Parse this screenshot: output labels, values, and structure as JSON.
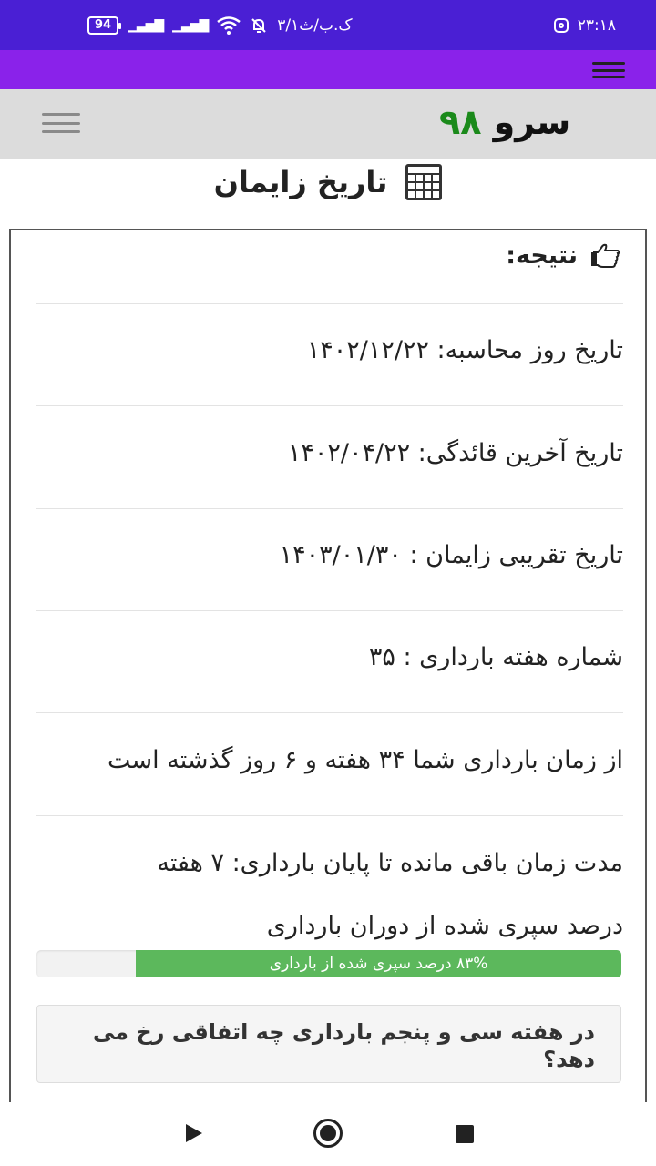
{
  "status_bar": {
    "time": "۲۳:۱۸",
    "speed": "۳/۱ک.ب/ث",
    "battery": "94"
  },
  "app": {
    "logo_word": "سرو",
    "logo_number": "۹۸"
  },
  "page": {
    "title": "تاریخ زایمان"
  },
  "result": {
    "heading": "نتیجه:",
    "calc_date": "تاریخ روز محاسبه: ۱۴۰۲/۱۲/۲۲",
    "last_period": "تاریخ آخرین قائدگی: ۱۴۰۲/۰۴/۲۲",
    "due_date": "تاریخ تقریبی زایمان : ۱۴۰۳/۰۱/۳۰",
    "week_number": "شماره هفته بارداری : ۳۵",
    "elapsed": "از زمان بارداری شما ۳۴ هفته و ۶ روز گذشته است",
    "remaining": "مدت زمان باقی مانده تا پایان بارداری: ۷ هفته",
    "percent_label": "درصد سپری شده از دوران بارداری",
    "progress_text": "۸۳% درصد سپری شده از بارداری",
    "progress_value": 0.83,
    "question": "در هفته سی و پنجم بارداری چه اتفاقی رخ می دهد؟"
  },
  "colors": {
    "status_bar": "#4a1fd4",
    "top_bar": "#8a22ea",
    "app_bar": "#dcdcdc",
    "logo_number": "#1b8a1b",
    "progress": "#5cb85c"
  }
}
